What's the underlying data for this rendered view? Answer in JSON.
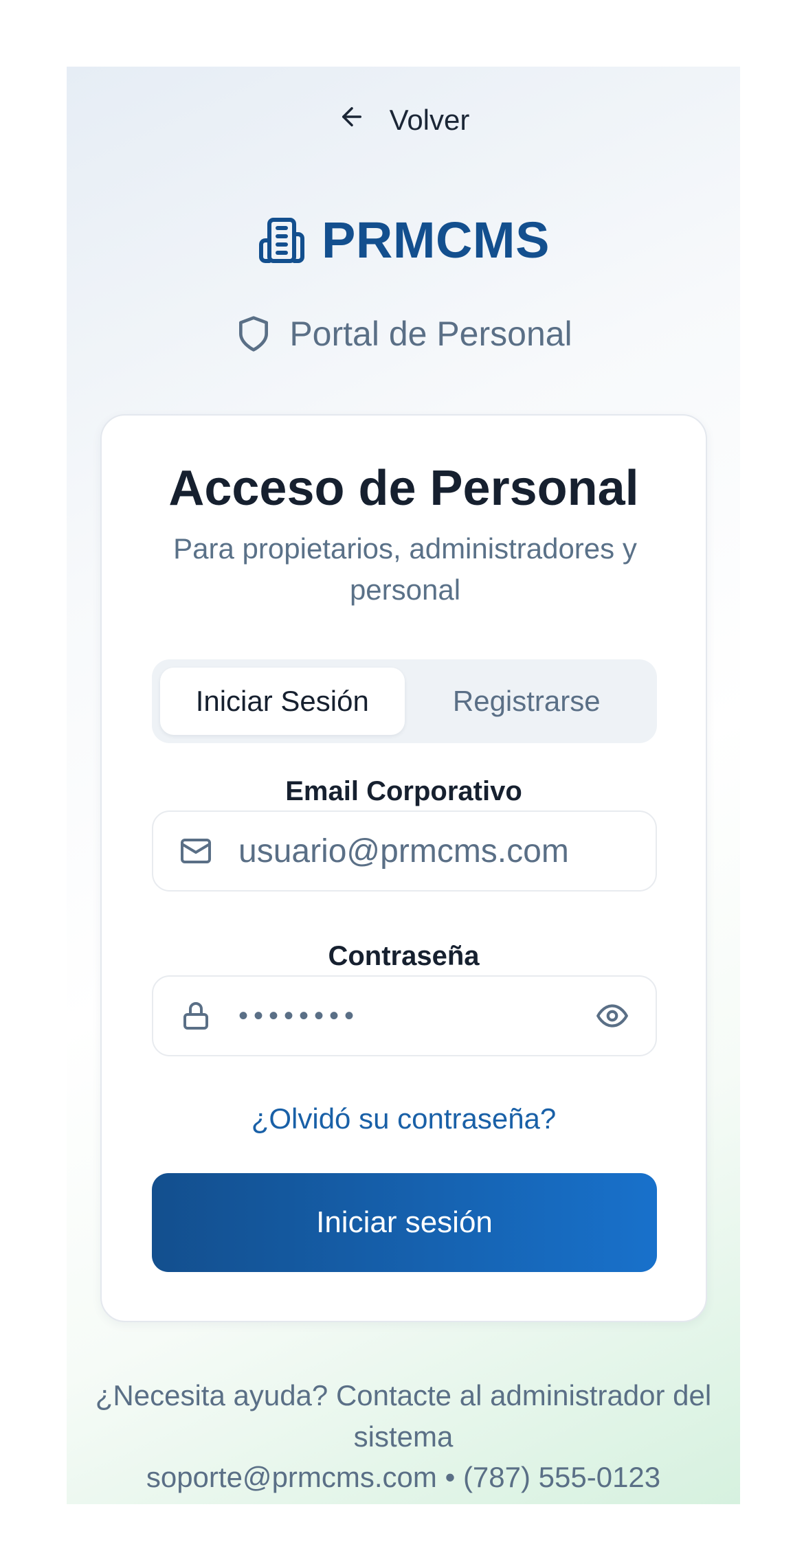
{
  "nav": {
    "back_label": "Volver"
  },
  "brand": {
    "name": "PRMCMS",
    "portal_label": "Portal de Personal"
  },
  "card": {
    "title": "Acceso de Personal",
    "subtitle": "Para propietarios, administradores y personal",
    "tabs": [
      {
        "label": "Iniciar Sesión",
        "active": true
      },
      {
        "label": "Registrarse",
        "active": false
      }
    ],
    "email": {
      "label": "Email Corporativo",
      "placeholder": "usuario@prmcms.com"
    },
    "password": {
      "label": "Contraseña",
      "value": "••••••••"
    },
    "forgot_label": "¿Olvidó su contraseña?",
    "submit_label": "Iniciar sesión"
  },
  "footer": {
    "help_text": "¿Necesita ayuda? Contacte al administrador del sistema",
    "contact": "soporte@prmcms.com • (787) 555-0123"
  },
  "icons": {
    "back": "arrow-left-icon",
    "logo": "building-icon",
    "portal": "shield-icon",
    "email": "mail-icon",
    "password": "lock-icon",
    "toggle": "eye-icon"
  },
  "colors": {
    "brand": "#134f8e",
    "accent": "#1871cb",
    "text": "#16202f",
    "muted": "#5a6f86",
    "link": "#1960a7"
  }
}
